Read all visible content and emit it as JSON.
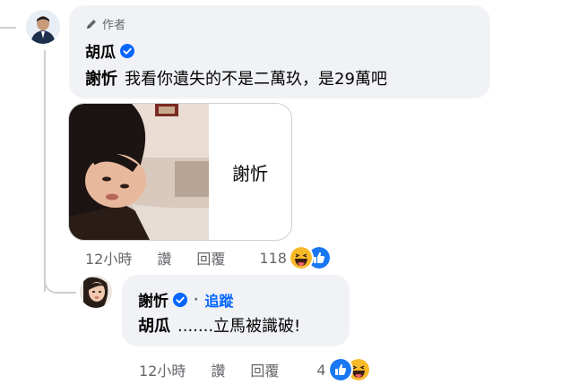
{
  "comment1": {
    "badge_label": "作者",
    "author_name": "胡瓜",
    "mention": "謝忻",
    "text": "我看你遺失的不是二萬玖，是29萬吧",
    "mention_card_name": "謝忻",
    "time": "12小時",
    "like_label": "讚",
    "reply_label": "回覆",
    "reaction_count": "118",
    "reactions": [
      "haha",
      "like"
    ]
  },
  "comment2": {
    "author_name": "謝忻",
    "separator": "·",
    "follow_label": "追蹤",
    "mention": "胡瓜",
    "text": ".......立馬被識破!",
    "time": "12小時",
    "like_label": "讚",
    "reply_label": "回覆",
    "reaction_count": "4",
    "reactions": [
      "like",
      "haha"
    ]
  },
  "colors": {
    "bubble": "#f0f2f5",
    "accent": "#0866ff",
    "muted": "#65676b"
  }
}
